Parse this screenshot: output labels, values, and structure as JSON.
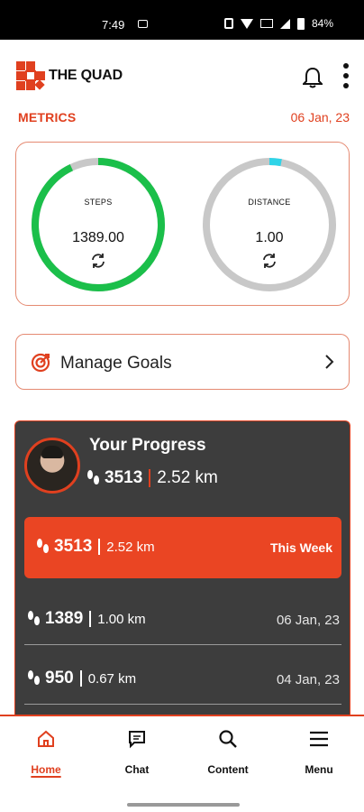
{
  "status_bar": {
    "time": "7:49",
    "battery": "84%"
  },
  "header": {
    "logo_text": "THE QUAD"
  },
  "metrics": {
    "label": "METRICS",
    "date": "06 Jan, 23"
  },
  "gauges": [
    {
      "label": "STEPS",
      "value": "1389.00",
      "progress": 0.93,
      "color": "#1bbf4a"
    },
    {
      "label": "DISTANCE",
      "value": "1.00",
      "progress": 0.03,
      "color": "#2fd4e8"
    }
  ],
  "goals": {
    "label": "Manage Goals"
  },
  "progress": {
    "title": "Your Progress",
    "total_steps": "3513",
    "total_distance": "2.52 km",
    "week": {
      "steps": "3513",
      "distance": "2.52 km",
      "label": "This Week"
    },
    "days": [
      {
        "steps": "1389",
        "distance": "1.00 km",
        "date": "06 Jan, 23"
      },
      {
        "steps": "950",
        "distance": "0.67 km",
        "date": "04 Jan, 23"
      }
    ]
  },
  "nav": [
    {
      "label": "Home",
      "icon": "home-icon",
      "active": true
    },
    {
      "label": "Chat",
      "icon": "chat-icon",
      "active": false
    },
    {
      "label": "Content",
      "icon": "search-icon",
      "active": false
    },
    {
      "label": "Menu",
      "icon": "menu-icon",
      "active": false
    }
  ],
  "colors": {
    "accent": "#e0401f",
    "card_dark": "#3d3d3d",
    "track_gray": "#c8c8c8"
  }
}
